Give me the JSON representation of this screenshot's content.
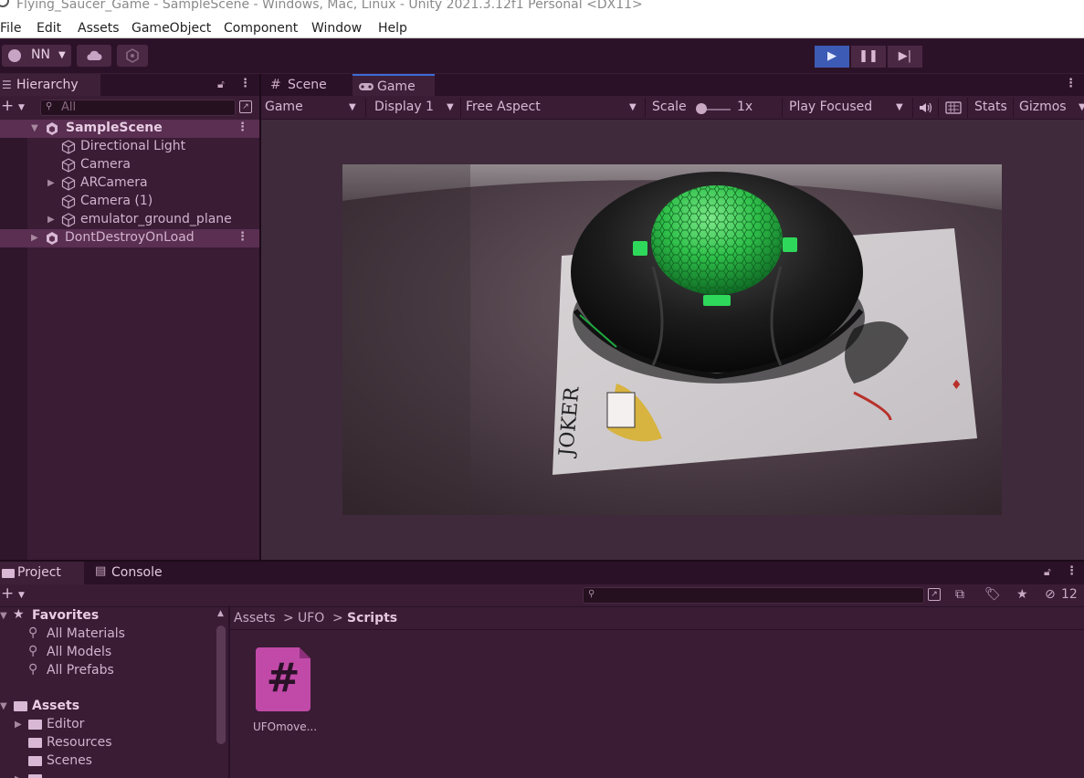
{
  "window": {
    "title": "Flying_Saucer_Game - SampleScene - Windows, Mac, Linux - Unity 2021.3.12f1 Personal <DX11>"
  },
  "menu": [
    "File",
    "Edit",
    "Assets",
    "GameObject",
    "Component",
    "Window",
    "Help"
  ],
  "toolbar": {
    "account_label": "NN",
    "play_state": "playing"
  },
  "hierarchy": {
    "tab_label": "Hierarchy",
    "search_placeholder": "All",
    "items": [
      {
        "label": "SampleScene",
        "bold": true,
        "selected": true,
        "type": "scene"
      },
      {
        "label": "Directional Light",
        "type": "object"
      },
      {
        "label": "Camera",
        "type": "object"
      },
      {
        "label": "ARCamera",
        "type": "object",
        "expandable": true
      },
      {
        "label": "Camera (1)",
        "type": "object"
      },
      {
        "label": "emulator_ground_plane",
        "type": "object",
        "expandable": true
      },
      {
        "label": "DontDestroyOnLoad",
        "type": "scene",
        "selected": true
      }
    ]
  },
  "game_view": {
    "tabs": [
      "Scene",
      "Game"
    ],
    "active_tab": "Game",
    "controls": {
      "mode": "Game",
      "display": "Display 1",
      "aspect": "Free Aspect",
      "scale_label": "Scale",
      "scale_value": "1x",
      "play_focus": "Play Focused",
      "stats": "Stats",
      "gizmos": "Gizmos"
    },
    "card_text": "JOKER"
  },
  "project": {
    "tabs": [
      "Project",
      "Console"
    ],
    "visibility_count": "12",
    "favorites": {
      "label": "Favorites",
      "items": [
        "All Materials",
        "All Models",
        "All Prefabs"
      ]
    },
    "assets": {
      "label": "Assets",
      "items": [
        "Editor",
        "Resources",
        "Scenes"
      ]
    },
    "breadcrumb": [
      "Assets",
      "UFO",
      "Scripts"
    ],
    "files": [
      {
        "name": "UFOmove...",
        "type": "script"
      }
    ]
  },
  "colors": {
    "accent": "#3d6cd8",
    "panel_bg": "#3a1c35",
    "script_icon": "#c14aa8"
  }
}
